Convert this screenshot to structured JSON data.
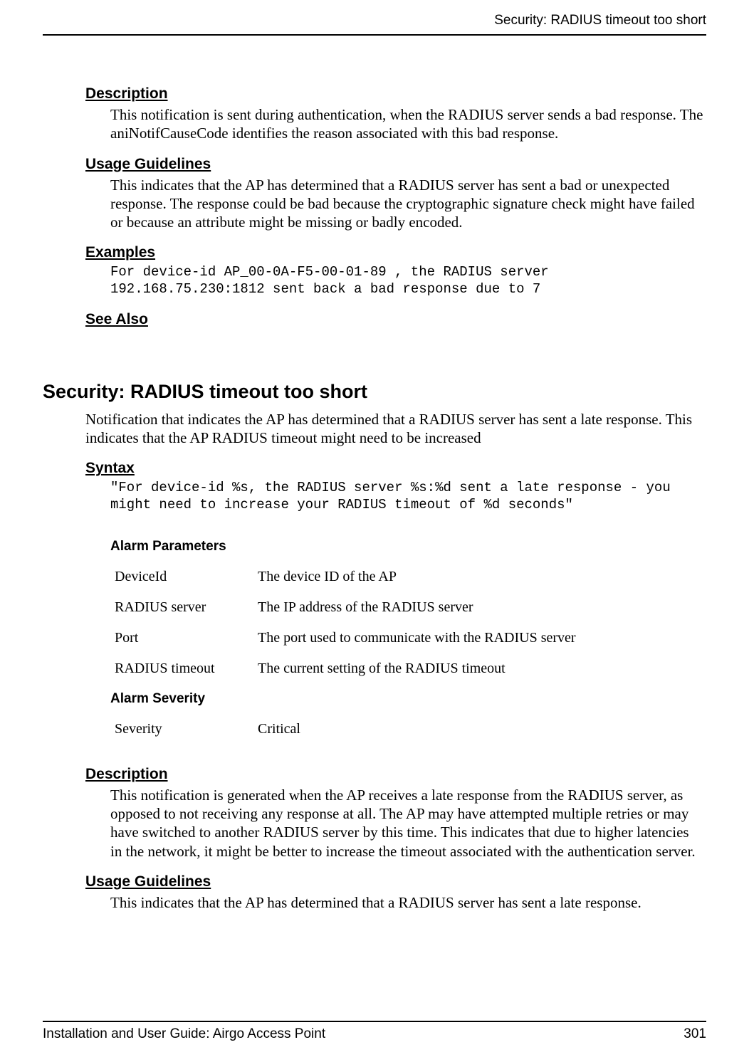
{
  "running_header": "Security: RADIUS timeout too short",
  "section1": {
    "description_h": "Description",
    "description_body": "This notification is sent during authentication, when the RADIUS server sends a bad response. The aniNotifCauseCode identifies the reason associated with this bad response.",
    "usage_h": "Usage Guidelines",
    "usage_body": "This indicates that the AP has determined that a RADIUS server has sent a bad or unexpected response. The response could be bad because the cryptographic signature check might have failed or because an attribute might be missing or badly encoded.",
    "examples_h": "Examples",
    "examples_body": "For device-id AP_00-0A-F5-00-01-89 , the RADIUS server 192.168.75.230:1812 sent back a bad response due to 7",
    "seealso_h": "See Also"
  },
  "section2": {
    "title": "Security: RADIUS timeout too short",
    "intro": "Notification that indicates the AP has determined that a RADIUS server has sent a late response. This indicates that the AP RADIUS timeout might need to be increased",
    "syntax_h": "Syntax",
    "syntax_body": "\"For device-id %s, the RADIUS server %s:%d sent a late response - you might need to increase your RADIUS timeout of %d seconds\"",
    "params_h": "Alarm Parameters",
    "params": [
      {
        "name": "DeviceId",
        "desc": "The device ID of the AP"
      },
      {
        "name": "RADIUS server",
        "desc": "The IP address of the RADIUS server"
      },
      {
        "name": "Port",
        "desc": "The port used to communicate with the RADIUS server"
      },
      {
        "name": "RADIUS timeout",
        "desc": "The current setting of the RADIUS timeout"
      }
    ],
    "severity_h": "Alarm Severity",
    "severity_name": "Severity",
    "severity_value": "Critical",
    "description_h": "Description",
    "description_body": "This notification is generated when the AP receives a late response from the RADIUS server, as opposed to not receiving any response at all. The AP may have attempted multiple retries or may have switched to another RADIUS server by this time. This indicates that due to higher latencies in the network, it might be better to increase the timeout associated with the authentication server.",
    "usage_h": "Usage Guidelines",
    "usage_body": "This indicates that the AP has determined that a RADIUS server has sent a late response."
  },
  "footer": {
    "left": "Installation and User Guide: Airgo Access Point",
    "right": "301"
  }
}
